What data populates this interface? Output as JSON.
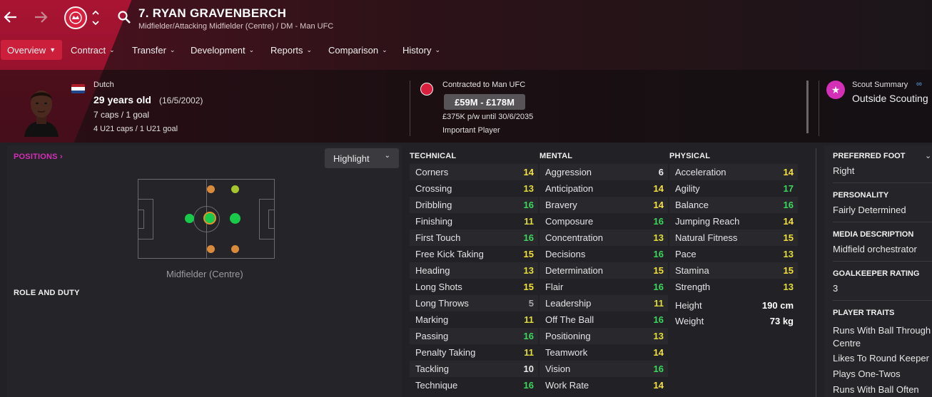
{
  "nav": {
    "back_icon": "arrow-left-icon",
    "forward_icon": "arrow-right-icon",
    "search_icon": "search-icon"
  },
  "player": {
    "title": "7. RYAN GRAVENBERCH",
    "subtitle": "Midfielder/Attacking Midfielder (Centre) / DM - Man UFC",
    "nationality": "Dutch",
    "age": "29 years old",
    "dob": "(16/5/2002)",
    "caps": "7 caps / 1 goal",
    "u21_caps": "4 U21 caps / 1 U21 goal"
  },
  "tabs": [
    {
      "label": "Overview",
      "active": true
    },
    {
      "label": "Contract"
    },
    {
      "label": "Transfer"
    },
    {
      "label": "Development"
    },
    {
      "label": "Reports"
    },
    {
      "label": "Comparison"
    },
    {
      "label": "History"
    }
  ],
  "contract": {
    "contracted": "Contracted to Man UFC",
    "value": "£59M - £178M",
    "wage": "£375K p/w until 30/6/2035",
    "status": "Important Player"
  },
  "scout": {
    "label": "Scout Summary",
    "value": "Outside Scouting"
  },
  "positions": {
    "header": "POSITIONS",
    "highlight": "Highlight",
    "position_label": "Midfielder (Centre)",
    "role_header": "ROLE AND DUTY"
  },
  "technical": {
    "header": "TECHNICAL",
    "rows": [
      {
        "name": "Corners",
        "value": "14"
      },
      {
        "name": "Crossing",
        "value": "13"
      },
      {
        "name": "Dribbling",
        "value": "16"
      },
      {
        "name": "Finishing",
        "value": "11"
      },
      {
        "name": "First Touch",
        "value": "16"
      },
      {
        "name": "Free Kick Taking",
        "value": "15"
      },
      {
        "name": "Heading",
        "value": "13"
      },
      {
        "name": "Long Shots",
        "value": "15"
      },
      {
        "name": "Long Throws",
        "value": "5"
      },
      {
        "name": "Marking",
        "value": "11"
      },
      {
        "name": "Passing",
        "value": "16"
      },
      {
        "name": "Penalty Taking",
        "value": "11"
      },
      {
        "name": "Tackling",
        "value": "10"
      },
      {
        "name": "Technique",
        "value": "16"
      }
    ]
  },
  "mental": {
    "header": "MENTAL",
    "rows": [
      {
        "name": "Aggression",
        "value": "6"
      },
      {
        "name": "Anticipation",
        "value": "14"
      },
      {
        "name": "Bravery",
        "value": "14"
      },
      {
        "name": "Composure",
        "value": "16"
      },
      {
        "name": "Concentration",
        "value": "13"
      },
      {
        "name": "Decisions",
        "value": "16"
      },
      {
        "name": "Determination",
        "value": "15"
      },
      {
        "name": "Flair",
        "value": "16"
      },
      {
        "name": "Leadership",
        "value": "11"
      },
      {
        "name": "Off The Ball",
        "value": "16"
      },
      {
        "name": "Positioning",
        "value": "13"
      },
      {
        "name": "Teamwork",
        "value": "14"
      },
      {
        "name": "Vision",
        "value": "16"
      },
      {
        "name": "Work Rate",
        "value": "14"
      }
    ]
  },
  "physical": {
    "header": "PHYSICAL",
    "rows": [
      {
        "name": "Acceleration",
        "value": "14"
      },
      {
        "name": "Agility",
        "value": "17"
      },
      {
        "name": "Balance",
        "value": "16"
      },
      {
        "name": "Jumping Reach",
        "value": "14"
      },
      {
        "name": "Natural Fitness",
        "value": "15"
      },
      {
        "name": "Pace",
        "value": "13"
      },
      {
        "name": "Stamina",
        "value": "15"
      },
      {
        "name": "Strength",
        "value": "13"
      }
    ],
    "height_label": "Height",
    "height": "190 cm",
    "weight_label": "Weight",
    "weight": "73 kg"
  },
  "info": {
    "foot_h": "PREFERRED FOOT",
    "foot": "Right",
    "personality_h": "PERSONALITY",
    "personality": "Fairly Determined",
    "media_h": "MEDIA DESCRIPTION",
    "media": "Midfield orchestrator",
    "gk_h": "GOALKEEPER RATING",
    "gk": "3",
    "traits_h": "PLAYER TRAITS",
    "traits": [
      "Runs With Ball Through Centre",
      "Likes To Round Keeper",
      "Plays One-Twos",
      "Runs With Ball Often"
    ]
  },
  "colors": {
    "accent": "#cc1f3b",
    "green": "#3cd65d",
    "yellow": "#f5e23e",
    "positions_header": "#d42fb7"
  }
}
